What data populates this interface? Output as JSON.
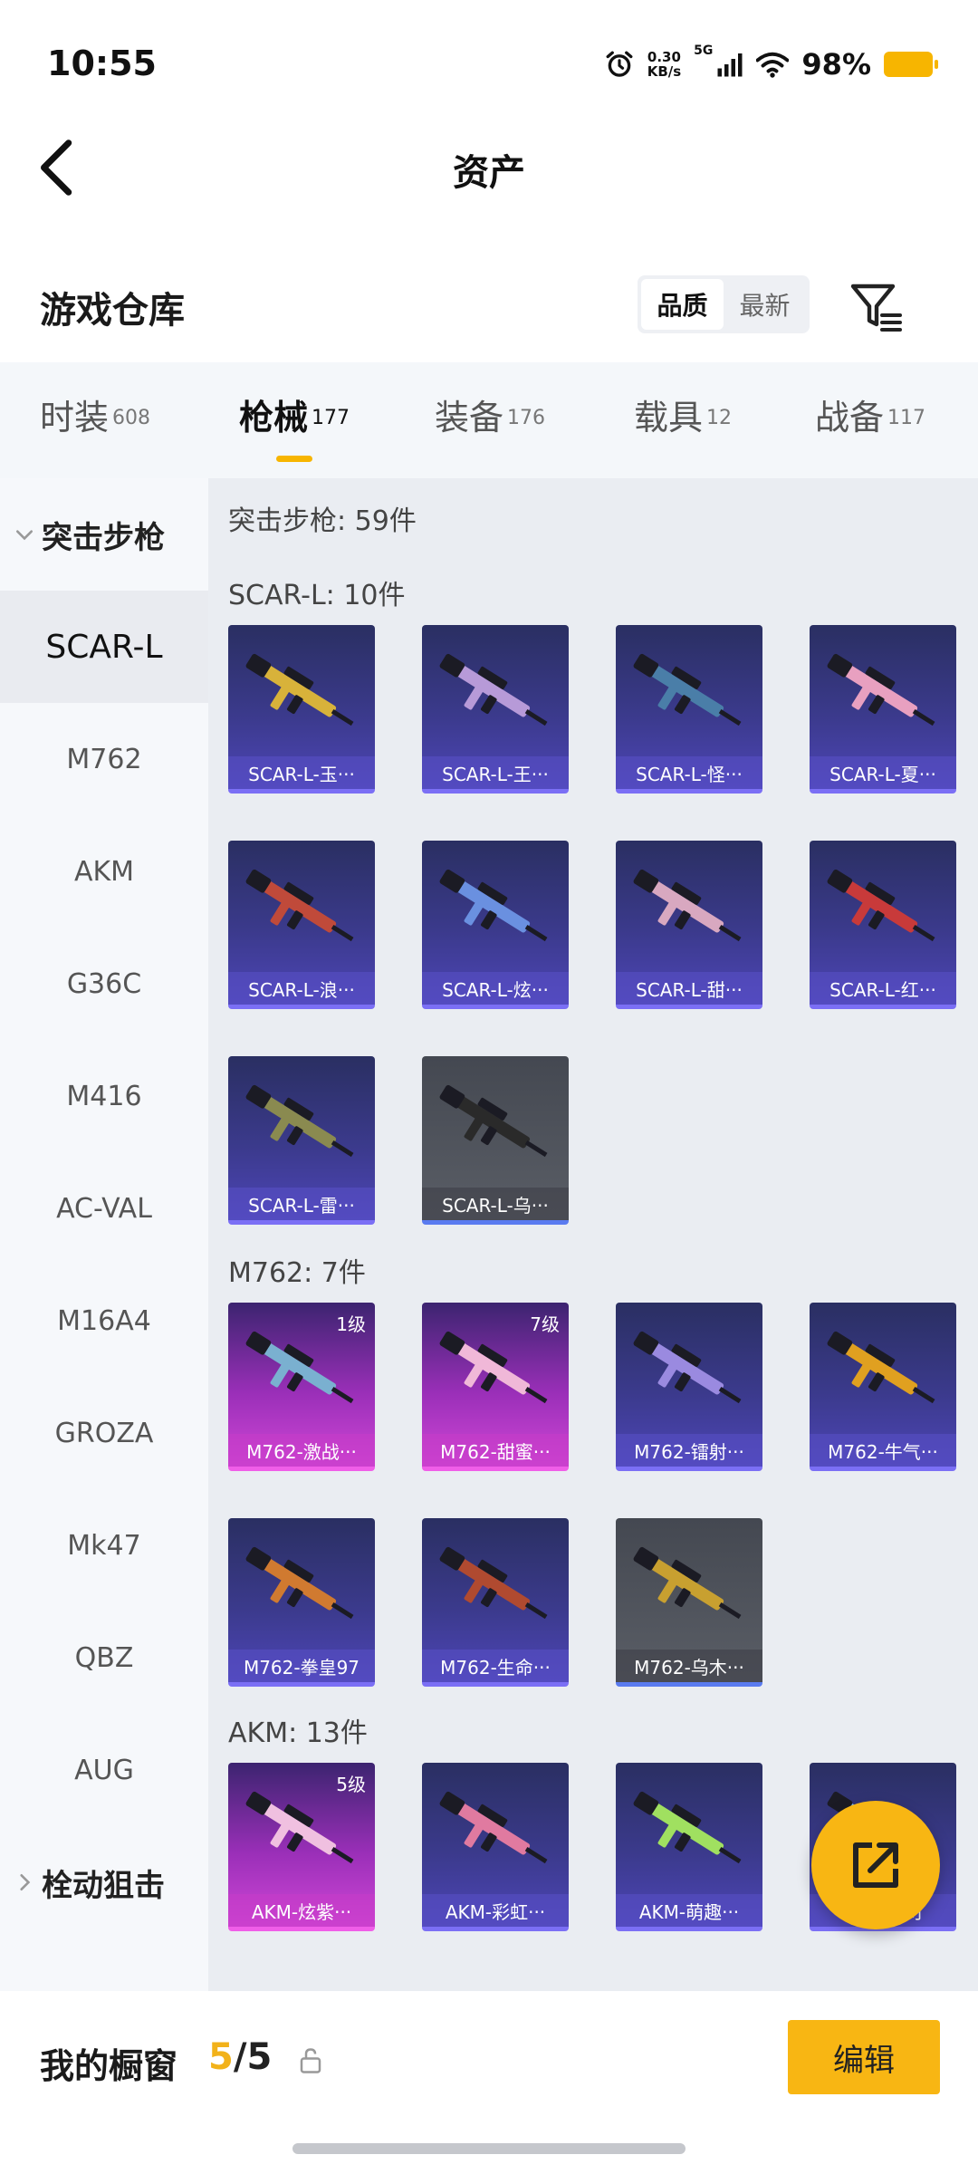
{
  "status_bar": {
    "time": "10:55",
    "speed_value": "0.30",
    "speed_unit": "KB/s",
    "network": "5G",
    "battery": "98%"
  },
  "header": {
    "title": "资产",
    "back_icon": "chevron-left-icon"
  },
  "warehouse": {
    "title": "游戏仓库",
    "sort_options": [
      "品质",
      "最新"
    ],
    "sort_selected": "品质",
    "filter_icon": "filter-icon"
  },
  "tabs": [
    {
      "label": "时装",
      "count": "608",
      "active": false
    },
    {
      "label": "枪械",
      "count": "177",
      "active": true
    },
    {
      "label": "装备",
      "count": "176",
      "active": false
    },
    {
      "label": "载具",
      "count": "12",
      "active": false
    },
    {
      "label": "战备",
      "count": "117",
      "active": false
    }
  ],
  "sidebar": {
    "group_open": "突击步枪",
    "items": [
      "SCAR-L",
      "M762",
      "AKM",
      "G36C",
      "M416",
      "AC-VAL",
      "M16A4",
      "GROZA",
      "Mk47",
      "QBZ",
      "AUG"
    ],
    "selected": "SCAR-L",
    "group_closed": "栓动狙击"
  },
  "content": {
    "category_header": "突击步枪: 59件",
    "sections": [
      {
        "header": "SCAR-L: 10件",
        "items": [
          {
            "name": "SCAR-L-玉···",
            "style": "blue",
            "accent": "#d8b23a",
            "level": ""
          },
          {
            "name": "SCAR-L-王···",
            "style": "blue",
            "accent": "#b79ad8",
            "level": ""
          },
          {
            "name": "SCAR-L-怪···",
            "style": "blue",
            "accent": "#4a7ea8",
            "level": ""
          },
          {
            "name": "SCAR-L-夏···",
            "style": "blue",
            "accent": "#e8a0c0",
            "level": ""
          },
          {
            "name": "SCAR-L-浪···",
            "style": "blue",
            "accent": "#c04a3a",
            "level": ""
          },
          {
            "name": "SCAR-L-炫···",
            "style": "blue",
            "accent": "#6a90e0",
            "level": ""
          },
          {
            "name": "SCAR-L-甜···",
            "style": "blue",
            "accent": "#d8a8c0",
            "level": ""
          },
          {
            "name": "SCAR-L-红···",
            "style": "blue",
            "accent": "#c83a3a",
            "level": ""
          },
          {
            "name": "SCAR-L-雷···",
            "style": "blue",
            "accent": "#8a8a50",
            "level": ""
          },
          {
            "name": "SCAR-L-乌···",
            "style": "gray",
            "accent": "#2a2a2a",
            "level": ""
          }
        ]
      },
      {
        "header": "M762: 7件",
        "items": [
          {
            "name": "M762-激战···",
            "style": "pink",
            "accent": "#7ab0d0",
            "level": "1级"
          },
          {
            "name": "M762-甜蜜···",
            "style": "pink",
            "accent": "#f0b8d8",
            "level": "7级"
          },
          {
            "name": "M762-镭射···",
            "style": "blue",
            "accent": "#9a8ae0",
            "level": ""
          },
          {
            "name": "M762-牛气···",
            "style": "blue",
            "accent": "#e0a020",
            "level": ""
          },
          {
            "name": "M762-拳皇97",
            "style": "blue",
            "accent": "#d07a30",
            "level": ""
          },
          {
            "name": "M762-生命···",
            "style": "blue",
            "accent": "#b04a30",
            "level": ""
          },
          {
            "name": "M762-乌木···",
            "style": "gray",
            "accent": "#c8a030",
            "level": ""
          }
        ]
      },
      {
        "header": "AKM: 13件",
        "items": [
          {
            "name": "AKM-炫紫···",
            "style": "pink",
            "accent": "#f0c0e0",
            "level": "5级"
          },
          {
            "name": "AKM-彩虹···",
            "style": "blue",
            "accent": "#e07aa0",
            "level": ""
          },
          {
            "name": "AKM-萌趣···",
            "style": "blue",
            "accent": "#a0e060",
            "level": ""
          },
          {
            "name": "AKM-夜灯",
            "style": "blue",
            "accent": "#80c0f0",
            "level": ""
          }
        ]
      }
    ]
  },
  "fab_icon": "share-icon",
  "bottom": {
    "showcase_label": "我的橱窗",
    "showcase_current": "5",
    "showcase_slash": "/",
    "showcase_total": "5",
    "lock_icon": "lock-icon",
    "edit_label": "编辑"
  }
}
